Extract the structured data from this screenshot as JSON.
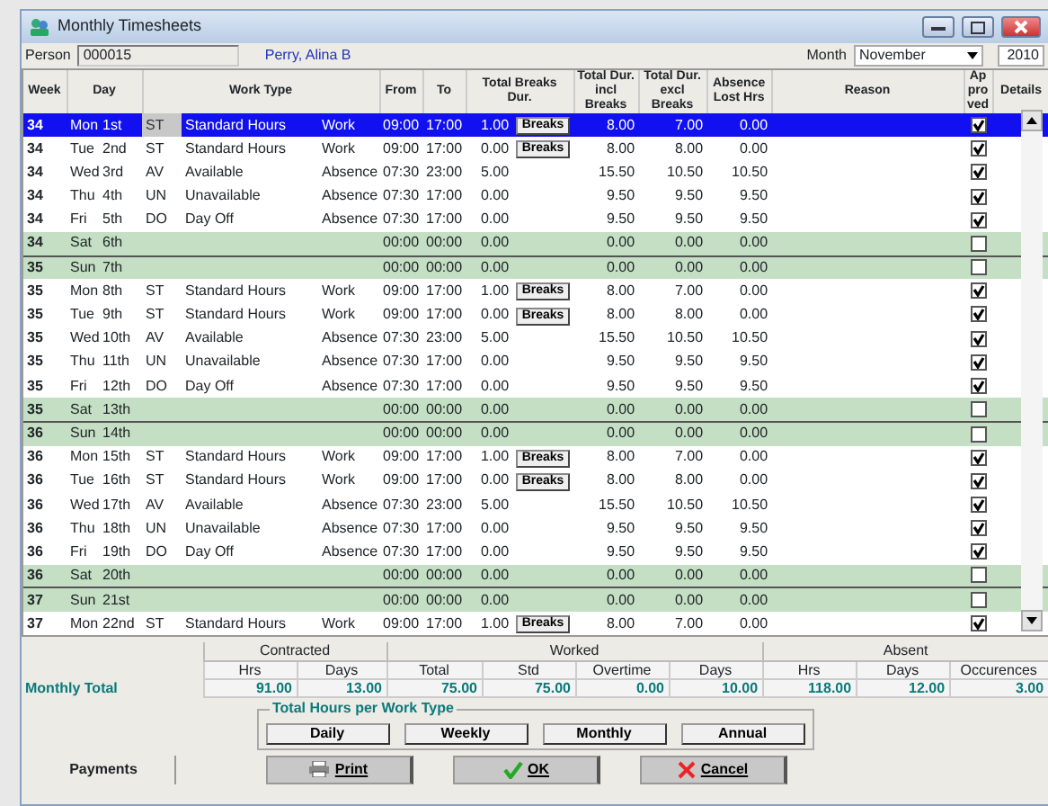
{
  "window": {
    "title": "Monthly Timesheets"
  },
  "person": {
    "label": "Person",
    "id": "000015",
    "name": "Perry, Alina B"
  },
  "month": {
    "label": "Month",
    "value": "November",
    "year": "2010"
  },
  "columns": [
    "Week",
    "Day",
    "Work Type",
    "From",
    "To",
    "Total Breaks Dur.",
    "Total Dur. incl Breaks",
    "Total Dur. excl Breaks",
    "Absence Lost Hrs",
    "Reason",
    "Approved",
    "Details"
  ],
  "rows": [
    {
      "kind": "weekday",
      "week": "34",
      "day": "Mon",
      "date": "1st",
      "code": "ST",
      "work_type": "Standard Hours",
      "category": "Work",
      "from": "09:00",
      "to": "17:00",
      "breaks": "1.00",
      "breaks_button": "Breaks",
      "incl": "8.00",
      "excl": "7.00",
      "absence": "0.00",
      "approved": true,
      "selected": true
    },
    {
      "kind": "weekday",
      "week": "34",
      "day": "Tue",
      "date": "2nd",
      "code": "ST",
      "work_type": "Standard Hours",
      "category": "Work",
      "from": "09:00",
      "to": "17:00",
      "breaks": "0.00",
      "breaks_button": "Breaks",
      "incl": "8.00",
      "excl": "8.00",
      "absence": "0.00",
      "approved": true,
      "selected": false
    },
    {
      "kind": "weekday",
      "week": "34",
      "day": "Wed",
      "date": "3rd",
      "code": "AV",
      "work_type": "Available",
      "category": "Absence",
      "from": "07:30",
      "to": "23:00",
      "breaks": "5.00",
      "incl": "15.50",
      "excl": "10.50",
      "absence": "10.50",
      "approved": true,
      "selected": false
    },
    {
      "kind": "weekday",
      "week": "34",
      "day": "Thu",
      "date": "4th",
      "code": "UN",
      "work_type": "Unavailable",
      "category": "Absence",
      "from": "07:30",
      "to": "17:00",
      "breaks": "0.00",
      "incl": "9.50",
      "excl": "9.50",
      "absence": "9.50",
      "approved": true,
      "selected": false
    },
    {
      "kind": "weekday",
      "week": "34",
      "day": "Fri",
      "date": "5th",
      "code": "DO",
      "work_type": "Day Off",
      "category": "Absence",
      "from": "07:30",
      "to": "17:00",
      "breaks": "0.00",
      "incl": "9.50",
      "excl": "9.50",
      "absence": "9.50",
      "approved": true,
      "selected": false
    },
    {
      "kind": "weekend",
      "week": "34",
      "day": "Sat",
      "date": "6th",
      "from": "00:00",
      "to": "00:00",
      "breaks": "0.00",
      "incl": "0.00",
      "excl": "0.00",
      "absence": "0.00",
      "approved": false,
      "selected": false
    },
    {
      "kind": "weekend",
      "week": "35",
      "day": "Sun",
      "date": "7th",
      "from": "00:00",
      "to": "00:00",
      "breaks": "0.00",
      "incl": "0.00",
      "excl": "0.00",
      "absence": "0.00",
      "approved": false,
      "selected": false
    },
    {
      "kind": "weekday",
      "week": "35",
      "day": "Mon",
      "date": "8th",
      "code": "ST",
      "work_type": "Standard Hours",
      "category": "Work",
      "from": "09:00",
      "to": "17:00",
      "breaks": "1.00",
      "breaks_button": "Breaks",
      "incl": "8.00",
      "excl": "7.00",
      "absence": "0.00",
      "approved": true,
      "selected": false
    },
    {
      "kind": "weekday",
      "week": "35",
      "day": "Tue",
      "date": "9th",
      "code": "ST",
      "work_type": "Standard Hours",
      "category": "Work",
      "from": "09:00",
      "to": "17:00",
      "breaks": "0.00",
      "breaks_button": "Breaks",
      "incl": "8.00",
      "excl": "8.00",
      "absence": "0.00",
      "approved": true,
      "selected": false
    },
    {
      "kind": "weekday",
      "week": "35",
      "day": "Wed",
      "date": "10th",
      "code": "AV",
      "work_type": "Available",
      "category": "Absence",
      "from": "07:30",
      "to": "23:00",
      "breaks": "5.00",
      "incl": "15.50",
      "excl": "10.50",
      "absence": "10.50",
      "approved": true,
      "selected": false
    },
    {
      "kind": "weekday",
      "week": "35",
      "day": "Thu",
      "date": "11th",
      "code": "UN",
      "work_type": "Unavailable",
      "category": "Absence",
      "from": "07:30",
      "to": "17:00",
      "breaks": "0.00",
      "incl": "9.50",
      "excl": "9.50",
      "absence": "9.50",
      "approved": true,
      "selected": false
    },
    {
      "kind": "weekday",
      "week": "35",
      "day": "Fri",
      "date": "12th",
      "code": "DO",
      "work_type": "Day Off",
      "category": "Absence",
      "from": "07:30",
      "to": "17:00",
      "breaks": "0.00",
      "incl": "9.50",
      "excl": "9.50",
      "absence": "9.50",
      "approved": true,
      "selected": false
    },
    {
      "kind": "weekend",
      "week": "35",
      "day": "Sat",
      "date": "13th",
      "from": "00:00",
      "to": "00:00",
      "breaks": "0.00",
      "incl": "0.00",
      "excl": "0.00",
      "absence": "0.00",
      "approved": false,
      "selected": false
    },
    {
      "kind": "weekend",
      "week": "36",
      "day": "Sun",
      "date": "14th",
      "from": "00:00",
      "to": "00:00",
      "breaks": "0.00",
      "incl": "0.00",
      "excl": "0.00",
      "absence": "0.00",
      "approved": false,
      "selected": false
    },
    {
      "kind": "weekday",
      "week": "36",
      "day": "Mon",
      "date": "15th",
      "code": "ST",
      "work_type": "Standard Hours",
      "category": "Work",
      "from": "09:00",
      "to": "17:00",
      "breaks": "1.00",
      "breaks_button": "Breaks",
      "incl": "8.00",
      "excl": "7.00",
      "absence": "0.00",
      "approved": true,
      "selected": false
    },
    {
      "kind": "weekday",
      "week": "36",
      "day": "Tue",
      "date": "16th",
      "code": "ST",
      "work_type": "Standard Hours",
      "category": "Work",
      "from": "09:00",
      "to": "17:00",
      "breaks": "0.00",
      "breaks_button": "Breaks",
      "incl": "8.00",
      "excl": "8.00",
      "absence": "0.00",
      "approved": true,
      "selected": false
    },
    {
      "kind": "weekday",
      "week": "36",
      "day": "Wed",
      "date": "17th",
      "code": "AV",
      "work_type": "Available",
      "category": "Absence",
      "from": "07:30",
      "to": "23:00",
      "breaks": "5.00",
      "incl": "15.50",
      "excl": "10.50",
      "absence": "10.50",
      "approved": true,
      "selected": false
    },
    {
      "kind": "weekday",
      "week": "36",
      "day": "Thu",
      "date": "18th",
      "code": "UN",
      "work_type": "Unavailable",
      "category": "Absence",
      "from": "07:30",
      "to": "17:00",
      "breaks": "0.00",
      "incl": "9.50",
      "excl": "9.50",
      "absence": "9.50",
      "approved": true,
      "selected": false
    },
    {
      "kind": "weekday",
      "week": "36",
      "day": "Fri",
      "date": "19th",
      "code": "DO",
      "work_type": "Day Off",
      "category": "Absence",
      "from": "07:30",
      "to": "17:00",
      "breaks": "0.00",
      "incl": "9.50",
      "excl": "9.50",
      "absence": "9.50",
      "approved": true,
      "selected": false
    },
    {
      "kind": "weekend",
      "week": "36",
      "day": "Sat",
      "date": "20th",
      "from": "00:00",
      "to": "00:00",
      "breaks": "0.00",
      "incl": "0.00",
      "excl": "0.00",
      "absence": "0.00",
      "approved": false,
      "selected": false
    },
    {
      "kind": "weekend",
      "week": "37",
      "day": "Sun",
      "date": "21st",
      "from": "00:00",
      "to": "00:00",
      "breaks": "0.00",
      "incl": "0.00",
      "excl": "0.00",
      "absence": "0.00",
      "approved": false,
      "selected": false
    },
    {
      "kind": "weekday",
      "week": "37",
      "day": "Mon",
      "date": "22nd",
      "code": "ST",
      "work_type": "Standard Hours",
      "category": "Work",
      "from": "09:00",
      "to": "17:00",
      "breaks": "1.00",
      "breaks_button": "Breaks",
      "incl": "8.00",
      "excl": "7.00",
      "absence": "0.00",
      "approved": true,
      "selected": false
    }
  ],
  "summary": {
    "groups": [
      "Contracted",
      "Worked",
      "Absent"
    ],
    "columns": [
      "Hrs",
      "Days",
      "Total",
      "Std",
      "Overtime",
      "Days",
      "Hrs",
      "Days",
      "Occurences"
    ],
    "total_label": "Monthly Total",
    "totals": [
      "91.00",
      "13.00",
      "75.00",
      "75.00",
      "0.00",
      "10.00",
      "118.00",
      "12.00",
      "3.00"
    ]
  },
  "work_type_totals": {
    "legend": "Total Hours per Work Type",
    "buttons": [
      "Daily",
      "Weekly",
      "Monthly",
      "Annual"
    ]
  },
  "footer": {
    "tab": "Payments",
    "buttons": [
      {
        "kind": "print",
        "label": "Print"
      },
      {
        "kind": "ok",
        "label": "OK"
      },
      {
        "kind": "cancel",
        "label": "Cancel"
      }
    ]
  }
}
